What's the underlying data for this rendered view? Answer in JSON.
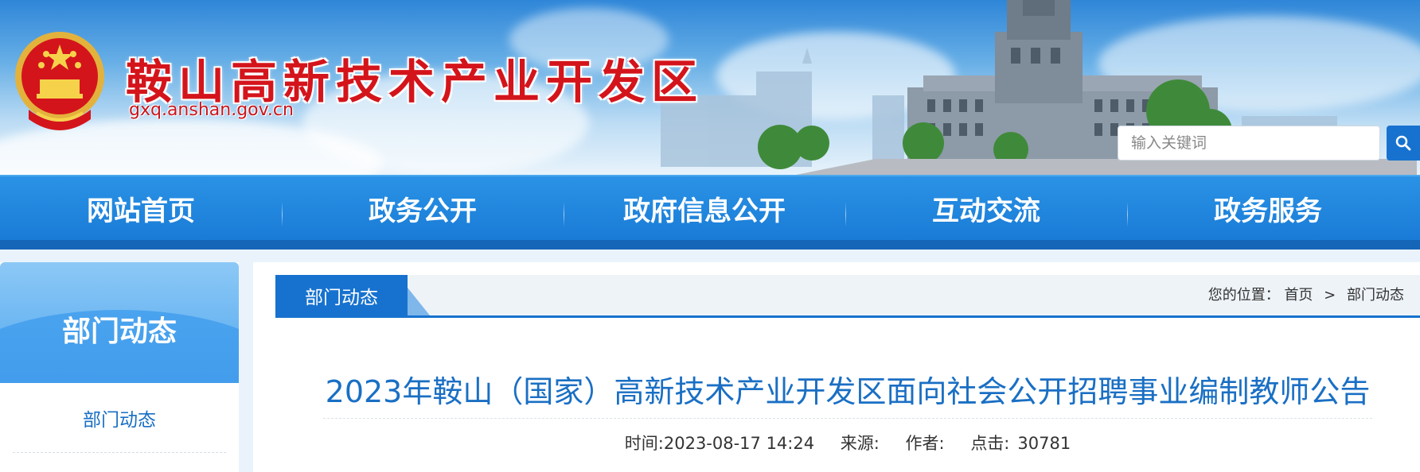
{
  "header": {
    "site_title": "鞍山高新技术产业开发区",
    "site_domain": "gxq.anshan.gov.cn",
    "emblem_icon": "national-emblem-icon",
    "search": {
      "placeholder": "输入关键词",
      "button_icon": "search-icon"
    }
  },
  "nav": {
    "items": [
      {
        "label": "网站首页"
      },
      {
        "label": "政务公开"
      },
      {
        "label": "政府信息公开"
      },
      {
        "label": "互动交流"
      },
      {
        "label": "政务服务"
      }
    ]
  },
  "sidebar": {
    "title": "部门动态",
    "items": [
      {
        "label": "部门动态"
      }
    ]
  },
  "main": {
    "tab_label": "部门动态",
    "breadcrumb": {
      "prefix": "您的位置：",
      "home": "首页",
      "separator": ">",
      "current": "部门动态"
    },
    "article": {
      "title": "2023年鞍山（国家）高新技术产业开发区面向社会公开招聘事业编制教师公告",
      "time": "时间:2023-08-17 14:24",
      "source": "来源:",
      "author": "作者:",
      "clicks_label": "点击:",
      "clicks_value": "30781"
    }
  },
  "colors": {
    "brand_blue": "#1772cf",
    "title_red": "#d4141b",
    "link_blue": "#1a6fc4"
  }
}
